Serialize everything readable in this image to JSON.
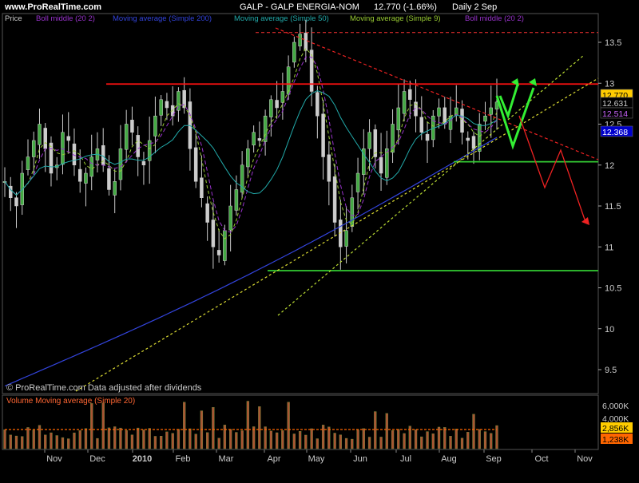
{
  "header": {
    "site": "www.ProRealTime.com",
    "title": "GALP - GALP ENERGIA-NOM",
    "last": "12.770 (-1.66%)",
    "period": "Daily 2 Sep"
  },
  "legend": [
    {
      "label": "Price",
      "color": "#cccccc"
    },
    {
      "label": "Boll middle (20 2)",
      "color": "#9933cc"
    },
    {
      "label": "Moving average (Simple 200)",
      "color": "#3344dd"
    },
    {
      "label": "Moving average (Simple 50)",
      "color": "#22aaaa"
    },
    {
      "label": "Moving average (Simple 9)",
      "color": "#99cc33"
    },
    {
      "label": "Boll middle (20 2)",
      "color": "#9933cc"
    }
  ],
  "footer": "© ProRealTime.com Data adjusted after dividends",
  "volume_legend": "Volume Moving average (Simple 20)",
  "chart_data": {
    "type": "candlestick",
    "ylim": [
      9.2,
      13.8
    ],
    "yticks": [
      "9.5",
      "10",
      "10.5",
      "11",
      "11.5",
      "12",
      "12.5",
      "13",
      "13.5"
    ],
    "xticks": [
      "Nov",
      "Dec",
      "2010",
      "Feb",
      "Mar",
      "Apr",
      "May",
      "Jun",
      "Jul",
      "Aug",
      "Sep",
      "Oct",
      "Nov"
    ],
    "price_badges": [
      {
        "text": "12.770",
        "value": 12.77,
        "bg": "#ffcc00",
        "fg": "#000000"
      },
      {
        "text": "12.631",
        "value": 12.631,
        "bg": "#000000",
        "fg": "#cccccc"
      },
      {
        "text": "12.514",
        "value": 12.514,
        "bg": "#000000",
        "fg": "#cc66ff"
      },
      {
        "text": "12.368",
        "value": 12.368,
        "bg": "#0000cc",
        "fg": "#ffffff"
      }
    ],
    "horizontal_lines": [
      {
        "value": 12.99,
        "color": "#ff1111",
        "style": "solid"
      },
      {
        "value": 13.62,
        "color": "#ff3333",
        "style": "dashed"
      },
      {
        "value": 10.71,
        "color": "#33cc33",
        "style": "solid"
      },
      {
        "value": 12.04,
        "color": "#33cc33",
        "style": "solid"
      }
    ],
    "series_close": [
      11.8,
      11.6,
      11.5,
      11.9,
      12.1,
      12.3,
      12.5,
      12.2,
      11.9,
      12.0,
      12.4,
      12.3,
      12.0,
      11.8,
      11.9,
      12.1,
      12.2,
      12.0,
      11.7,
      11.8,
      12.2,
      12.5,
      12.4,
      12.1,
      12.0,
      12.3,
      12.6,
      12.8,
      12.7,
      12.6,
      12.9,
      12.7,
      12.2,
      11.8,
      11.6,
      11.3,
      11.0,
      10.9,
      11.2,
      11.5,
      11.7,
      12.0,
      12.2,
      12.4,
      12.3,
      12.6,
      12.8,
      12.7,
      12.9,
      13.2,
      13.5,
      13.6,
      13.4,
      12.9,
      12.6,
      12.1,
      11.8,
      11.3,
      11.0,
      11.2,
      11.6,
      11.9,
      12.2,
      12.4,
      12.1,
      11.9,
      12.2,
      12.5,
      12.7,
      12.9,
      12.8,
      12.6,
      12.4,
      12.3,
      12.6,
      12.7,
      12.5,
      12.6,
      12.7,
      12.4,
      12.3,
      12.2,
      12.5,
      12.6,
      12.7,
      12.77
    ],
    "volume_ma_level": 2856,
    "volume_badges": [
      {
        "text": "2,856K",
        "bg": "#ffcc00",
        "fg": "#000000"
      },
      {
        "text": "1,238K",
        "bg": "#ff6600",
        "fg": "#000000"
      }
    ],
    "volume_yticks": [
      "6,000K",
      "4,000K"
    ]
  }
}
